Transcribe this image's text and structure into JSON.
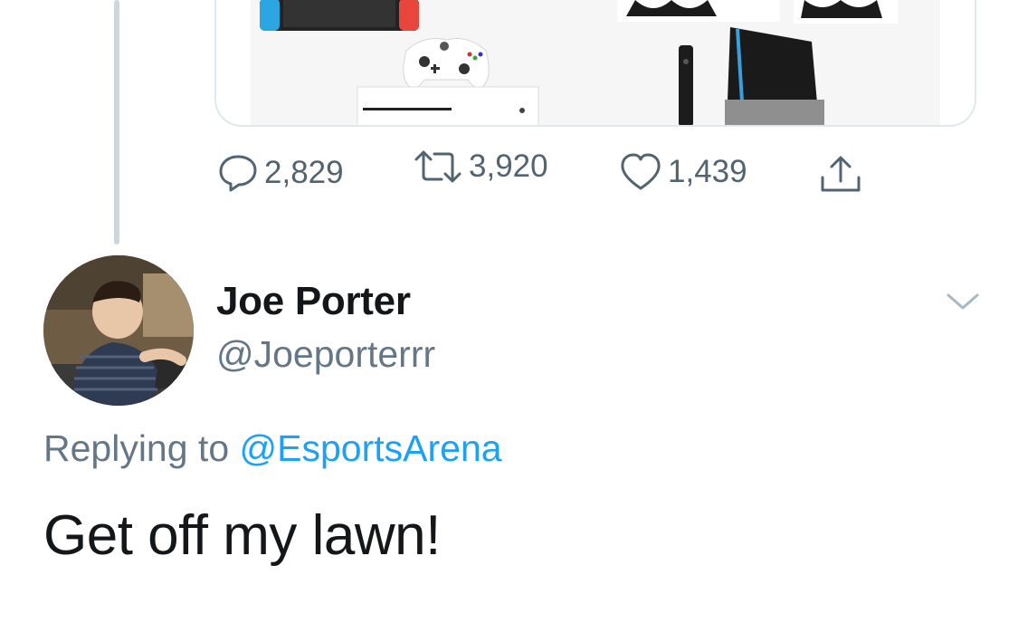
{
  "original_tweet": {
    "media_alt": "game consoles image",
    "stats": {
      "replies": "2,829",
      "retweets": "3,920",
      "likes": "1,439"
    },
    "icons": {
      "reply": "reply-icon",
      "retweet": "retweet-icon",
      "like": "heart-icon",
      "share": "share-icon"
    }
  },
  "reply_tweet": {
    "author": {
      "display_name": "Joe Porter",
      "handle": "@Joeporterrr"
    },
    "replying_prefix": "Replying to",
    "replying_handle": "@EsportsArena",
    "text": "Get off my lawn!"
  },
  "colors": {
    "link_blue": "#1da1f2",
    "secondary_gray": "#657786",
    "thread_line": "#ccd6dd"
  }
}
